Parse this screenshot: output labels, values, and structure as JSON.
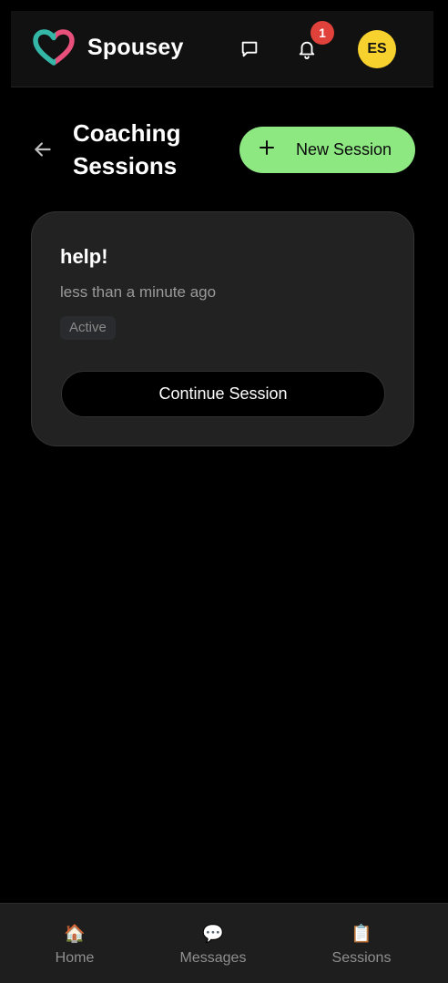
{
  "header": {
    "brand": "Spousey",
    "notification_count": "1",
    "avatar_initials": "ES",
    "icons": [
      "heart-logo-icon",
      "chat-icon",
      "bell-icon"
    ]
  },
  "page": {
    "title": "Coaching Sessions",
    "new_session_label": "New Session"
  },
  "sessions": [
    {
      "title": "help!",
      "time": "less than a minute ago",
      "status": "Active",
      "action_label": "Continue Session"
    }
  ],
  "bottom_nav": {
    "items": [
      {
        "label": "Home",
        "icon": "🏠"
      },
      {
        "label": "Messages",
        "icon": "💬"
      },
      {
        "label": "Sessions",
        "icon": "📋"
      }
    ]
  },
  "colors": {
    "accent_green": "#8ee882",
    "badge_red": "#e0413a",
    "avatar_yellow": "#f7d12e",
    "logo_teal": "#35b7a8",
    "logo_pink": "#e8507c"
  }
}
